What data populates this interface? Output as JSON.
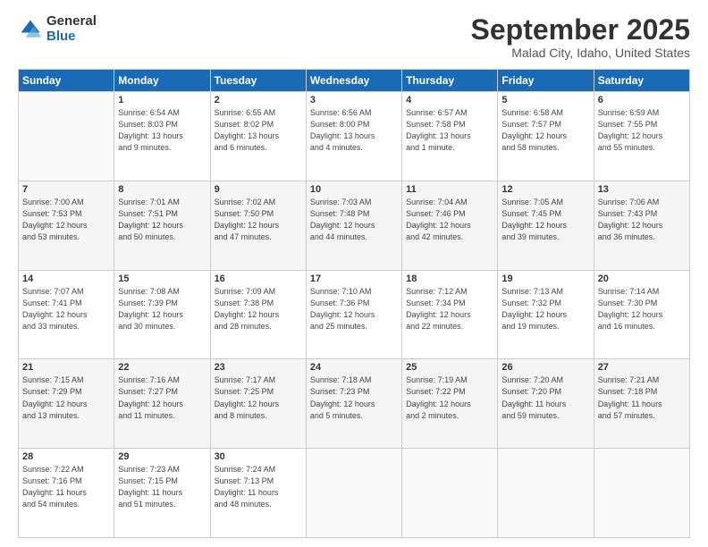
{
  "logo": {
    "general": "General",
    "blue": "Blue"
  },
  "header": {
    "month": "September 2025",
    "location": "Malad City, Idaho, United States"
  },
  "weekdays": [
    "Sunday",
    "Monday",
    "Tuesday",
    "Wednesday",
    "Thursday",
    "Friday",
    "Saturday"
  ],
  "weeks": [
    [
      {
        "day": "",
        "info": ""
      },
      {
        "day": "1",
        "info": "Sunrise: 6:54 AM\nSunset: 8:03 PM\nDaylight: 13 hours\nand 9 minutes."
      },
      {
        "day": "2",
        "info": "Sunrise: 6:55 AM\nSunset: 8:02 PM\nDaylight: 13 hours\nand 6 minutes."
      },
      {
        "day": "3",
        "info": "Sunrise: 6:56 AM\nSunset: 8:00 PM\nDaylight: 13 hours\nand 4 minutes."
      },
      {
        "day": "4",
        "info": "Sunrise: 6:57 AM\nSunset: 7:58 PM\nDaylight: 13 hours\nand 1 minute."
      },
      {
        "day": "5",
        "info": "Sunrise: 6:58 AM\nSunset: 7:57 PM\nDaylight: 12 hours\nand 58 minutes."
      },
      {
        "day": "6",
        "info": "Sunrise: 6:59 AM\nSunset: 7:55 PM\nDaylight: 12 hours\nand 55 minutes."
      }
    ],
    [
      {
        "day": "7",
        "info": "Sunrise: 7:00 AM\nSunset: 7:53 PM\nDaylight: 12 hours\nand 53 minutes."
      },
      {
        "day": "8",
        "info": "Sunrise: 7:01 AM\nSunset: 7:51 PM\nDaylight: 12 hours\nand 50 minutes."
      },
      {
        "day": "9",
        "info": "Sunrise: 7:02 AM\nSunset: 7:50 PM\nDaylight: 12 hours\nand 47 minutes."
      },
      {
        "day": "10",
        "info": "Sunrise: 7:03 AM\nSunset: 7:48 PM\nDaylight: 12 hours\nand 44 minutes."
      },
      {
        "day": "11",
        "info": "Sunrise: 7:04 AM\nSunset: 7:46 PM\nDaylight: 12 hours\nand 42 minutes."
      },
      {
        "day": "12",
        "info": "Sunrise: 7:05 AM\nSunset: 7:45 PM\nDaylight: 12 hours\nand 39 minutes."
      },
      {
        "day": "13",
        "info": "Sunrise: 7:06 AM\nSunset: 7:43 PM\nDaylight: 12 hours\nand 36 minutes."
      }
    ],
    [
      {
        "day": "14",
        "info": "Sunrise: 7:07 AM\nSunset: 7:41 PM\nDaylight: 12 hours\nand 33 minutes."
      },
      {
        "day": "15",
        "info": "Sunrise: 7:08 AM\nSunset: 7:39 PM\nDaylight: 12 hours\nand 30 minutes."
      },
      {
        "day": "16",
        "info": "Sunrise: 7:09 AM\nSunset: 7:38 PM\nDaylight: 12 hours\nand 28 minutes."
      },
      {
        "day": "17",
        "info": "Sunrise: 7:10 AM\nSunset: 7:36 PM\nDaylight: 12 hours\nand 25 minutes."
      },
      {
        "day": "18",
        "info": "Sunrise: 7:12 AM\nSunset: 7:34 PM\nDaylight: 12 hours\nand 22 minutes."
      },
      {
        "day": "19",
        "info": "Sunrise: 7:13 AM\nSunset: 7:32 PM\nDaylight: 12 hours\nand 19 minutes."
      },
      {
        "day": "20",
        "info": "Sunrise: 7:14 AM\nSunset: 7:30 PM\nDaylight: 12 hours\nand 16 minutes."
      }
    ],
    [
      {
        "day": "21",
        "info": "Sunrise: 7:15 AM\nSunset: 7:29 PM\nDaylight: 12 hours\nand 13 minutes."
      },
      {
        "day": "22",
        "info": "Sunrise: 7:16 AM\nSunset: 7:27 PM\nDaylight: 12 hours\nand 11 minutes."
      },
      {
        "day": "23",
        "info": "Sunrise: 7:17 AM\nSunset: 7:25 PM\nDaylight: 12 hours\nand 8 minutes."
      },
      {
        "day": "24",
        "info": "Sunrise: 7:18 AM\nSunset: 7:23 PM\nDaylight: 12 hours\nand 5 minutes."
      },
      {
        "day": "25",
        "info": "Sunrise: 7:19 AM\nSunset: 7:22 PM\nDaylight: 12 hours\nand 2 minutes."
      },
      {
        "day": "26",
        "info": "Sunrise: 7:20 AM\nSunset: 7:20 PM\nDaylight: 11 hours\nand 59 minutes."
      },
      {
        "day": "27",
        "info": "Sunrise: 7:21 AM\nSunset: 7:18 PM\nDaylight: 11 hours\nand 57 minutes."
      }
    ],
    [
      {
        "day": "28",
        "info": "Sunrise: 7:22 AM\nSunset: 7:16 PM\nDaylight: 11 hours\nand 54 minutes."
      },
      {
        "day": "29",
        "info": "Sunrise: 7:23 AM\nSunset: 7:15 PM\nDaylight: 11 hours\nand 51 minutes."
      },
      {
        "day": "30",
        "info": "Sunrise: 7:24 AM\nSunset: 7:13 PM\nDaylight: 11 hours\nand 48 minutes."
      },
      {
        "day": "",
        "info": ""
      },
      {
        "day": "",
        "info": ""
      },
      {
        "day": "",
        "info": ""
      },
      {
        "day": "",
        "info": ""
      }
    ]
  ]
}
